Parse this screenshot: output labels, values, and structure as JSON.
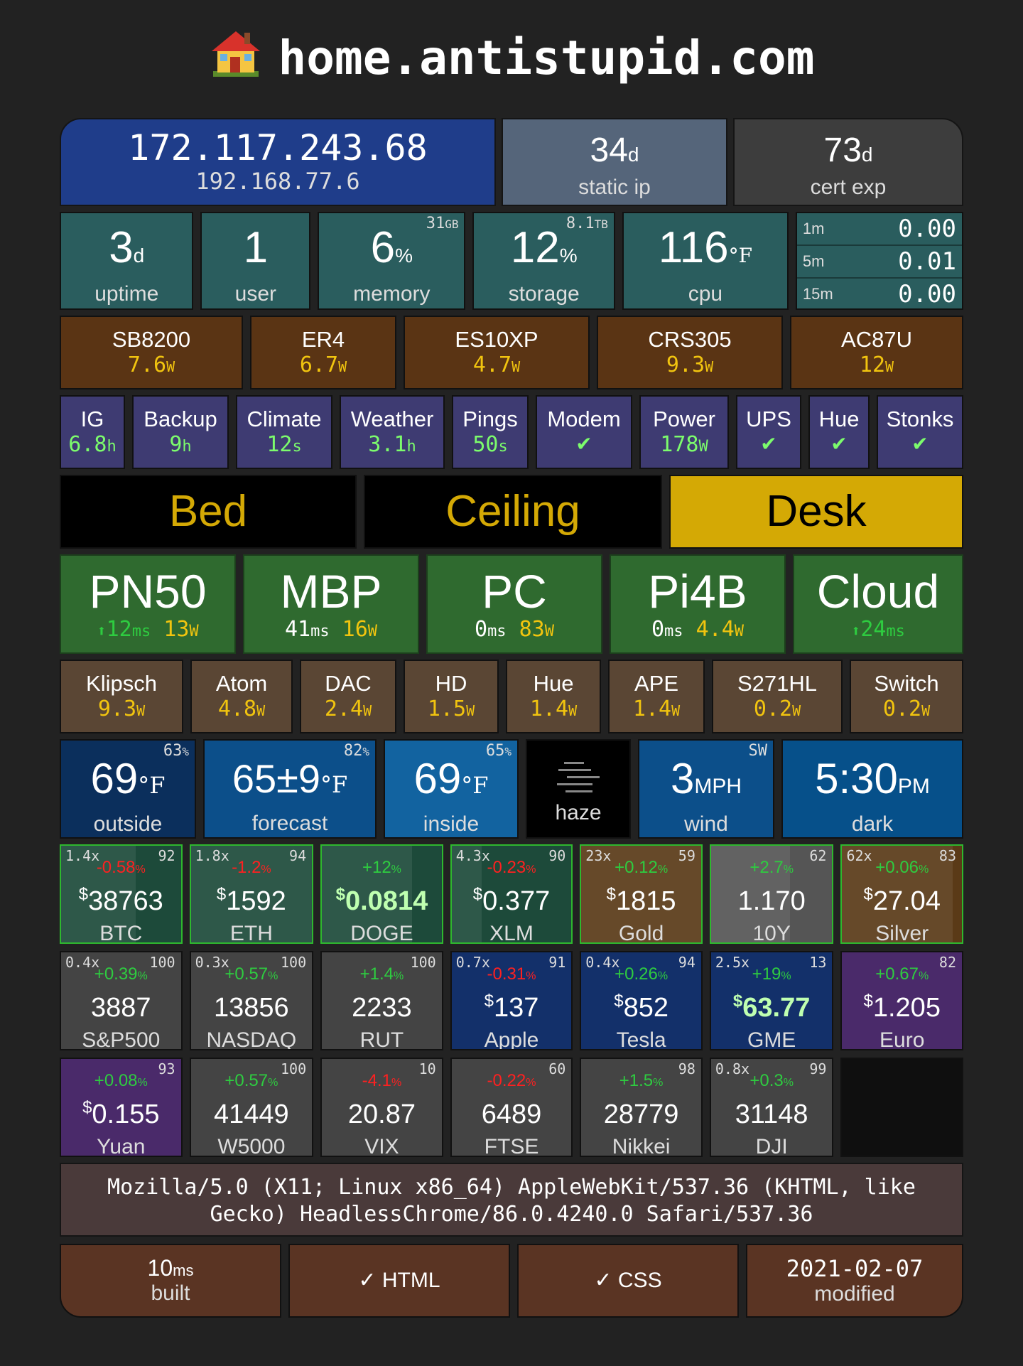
{
  "title": "home.antistupid.com",
  "network": {
    "public_ip": "172.117.243.68",
    "local_ip": "192.168.77.6",
    "static_ip": {
      "value": "34",
      "unit": "d",
      "label": "static ip"
    },
    "cert_exp": {
      "value": "73",
      "unit": "d",
      "label": "cert exp"
    }
  },
  "system": [
    {
      "value": "3",
      "unit": "d",
      "label": "uptime",
      "corner": ""
    },
    {
      "value": "1",
      "unit": "",
      "label": "user",
      "corner": ""
    },
    {
      "value": "6",
      "unit": "%",
      "label": "memory",
      "corner": "31",
      "corner_unit": "GB"
    },
    {
      "value": "12",
      "unit": "%",
      "label": "storage",
      "corner": "8.1",
      "corner_unit": "TB"
    },
    {
      "value": "116",
      "unit": "°F",
      "label": "cpu",
      "corner": ""
    }
  ],
  "load": [
    {
      "label": "1m",
      "value": "0.00"
    },
    {
      "label": "5m",
      "value": "0.01"
    },
    {
      "label": "15m",
      "value": "0.00"
    }
  ],
  "network_devices": [
    {
      "name": "SB8200",
      "value": "7.6",
      "unit": "W"
    },
    {
      "name": "ER4",
      "value": "6.7",
      "unit": "W"
    },
    {
      "name": "ES10XP",
      "value": "4.7",
      "unit": "W"
    },
    {
      "name": "CRS305",
      "value": "9.3",
      "unit": "W"
    },
    {
      "name": "AC87U",
      "value": "12",
      "unit": "W"
    }
  ],
  "jobs": [
    {
      "name": "IG",
      "value": "6.8",
      "unit": "h"
    },
    {
      "name": "Backup",
      "value": "9",
      "unit": "h"
    },
    {
      "name": "Climate",
      "value": "12",
      "unit": "s"
    },
    {
      "name": "Weather",
      "value": "3.1",
      "unit": "h"
    },
    {
      "name": "Pings",
      "value": "50",
      "unit": "s"
    },
    {
      "name": "Modem",
      "value": "✔",
      "unit": ""
    },
    {
      "name": "Power",
      "value": "178",
      "unit": "W"
    },
    {
      "name": "UPS",
      "value": "✔",
      "unit": ""
    },
    {
      "name": "Hue",
      "value": "✔",
      "unit": ""
    },
    {
      "name": "Stonks",
      "value": "✔",
      "unit": ""
    }
  ],
  "lights": [
    {
      "name": "Bed",
      "on": false
    },
    {
      "name": "Ceiling",
      "on": false
    },
    {
      "name": "Desk",
      "on": true
    }
  ],
  "machines": [
    {
      "name": "PN50",
      "arrow": "⬆",
      "ping": "12",
      "ping_unit": "ms",
      "power": "13",
      "power_unit": "W",
      "ping_green": true
    },
    {
      "name": "MBP",
      "arrow": "",
      "ping": "41",
      "ping_unit": "ms",
      "power": "16",
      "power_unit": "W",
      "ping_green": false
    },
    {
      "name": "PC",
      "arrow": "",
      "ping": "0",
      "ping_unit": "ms",
      "power": "83",
      "power_unit": "W",
      "ping_green": false
    },
    {
      "name": "Pi4B",
      "arrow": "",
      "ping": "0",
      "ping_unit": "ms",
      "power": "4.4",
      "power_unit": "W",
      "ping_green": false
    },
    {
      "name": "Cloud",
      "arrow": "⬆",
      "ping": "24",
      "ping_unit": "ms",
      "power": "",
      "power_unit": "",
      "ping_green": true
    }
  ],
  "peripherals": [
    {
      "name": "Klipsch",
      "value": "9.3",
      "unit": "W"
    },
    {
      "name": "Atom",
      "value": "4.8",
      "unit": "W"
    },
    {
      "name": "DAC",
      "value": "2.4",
      "unit": "W"
    },
    {
      "name": "HD",
      "value": "1.5",
      "unit": "W"
    },
    {
      "name": "Hue",
      "value": "1.4",
      "unit": "W"
    },
    {
      "name": "APE",
      "value": "1.4",
      "unit": "W"
    },
    {
      "name": "S271HL",
      "value": "0.2",
      "unit": "W"
    },
    {
      "name": "Switch",
      "value": "0.2",
      "unit": "W"
    }
  ],
  "weather": {
    "outside": {
      "value": "69",
      "unit": "°F",
      "label": "outside",
      "corner": "63",
      "corner_unit": "%"
    },
    "forecast": {
      "value": "65±9",
      "unit": "°F",
      "label": "forecast",
      "corner": "82",
      "corner_unit": "%"
    },
    "inside": {
      "value": "69",
      "unit": "°F",
      "label": "inside",
      "corner": "65",
      "corner_unit": "%"
    },
    "condition": {
      "label": "haze",
      "icon": "haze-icon"
    },
    "wind": {
      "value": "3",
      "unit": "MPH",
      "label": "wind",
      "corner": "SW"
    },
    "time": {
      "value": "5:30",
      "unit": "PM",
      "label": "dark"
    }
  },
  "stocks_row1": [
    {
      "name": "BTC",
      "mult": "1.4x",
      "score": "92",
      "change": "-0.58",
      "change_unit": "%",
      "dollar": "$",
      "price": "38763",
      "dir": "down",
      "bg": "#1d4a3a",
      "fill": 0.62,
      "border": "#2eb82e",
      "bold": false
    },
    {
      "name": "ETH",
      "mult": "1.8x",
      "score": "94",
      "change": "-1.2",
      "change_unit": "%",
      "dollar": "$",
      "price": "1592",
      "dir": "down",
      "bg": "#1d4a3a",
      "fill": 1.0,
      "border": "#2eb82e",
      "bold": false
    },
    {
      "name": "DOGE",
      "mult": "",
      "score": "",
      "change": "+12",
      "change_unit": "%",
      "dollar": "$",
      "price": "0.0814",
      "dir": "up",
      "bg": "#1d4a3a",
      "fill": 0.75,
      "border": "#2eb82e",
      "bold": true
    },
    {
      "name": "XLM",
      "mult": "4.3x",
      "score": "90",
      "change": "-0.23",
      "change_unit": "%",
      "dollar": "$",
      "price": "0.377",
      "dir": "down",
      "bg": "#1d4a3a",
      "fill": 0.25,
      "border": "#2eb82e",
      "bold": false
    },
    {
      "name": "Gold",
      "mult": "23x",
      "score": "59",
      "change": "+0.12",
      "change_unit": "%",
      "dollar": "$",
      "price": "1815",
      "dir": "up",
      "bg": "#5a3a17",
      "fill": 1.0,
      "border": "#2eb82e",
      "bold": false
    },
    {
      "name": "10Y",
      "mult": "",
      "score": "62",
      "change": "+2.7",
      "change_unit": "%",
      "dollar": "",
      "price": "1.170",
      "dir": "up",
      "bg": "#555555",
      "fill": 0.65,
      "border": "#2eb82e",
      "bold": false
    },
    {
      "name": "Silver",
      "mult": "62x",
      "score": "83",
      "change": "+0.06",
      "change_unit": "%",
      "dollar": "$",
      "price": "27.04",
      "dir": "up",
      "bg": "#5a3a17",
      "fill": 0.92,
      "border": "#2eb82e",
      "bold": false
    }
  ],
  "stocks_row2": [
    {
      "name": "S&P500",
      "mult": "0.4x",
      "score": "100",
      "change": "+0.39",
      "change_unit": "%",
      "dollar": "",
      "price": "3887",
      "dir": "up",
      "bg": "#444444",
      "bold": false
    },
    {
      "name": "NASDAQ",
      "mult": "0.3x",
      "score": "100",
      "change": "+0.57",
      "change_unit": "%",
      "dollar": "",
      "price": "13856",
      "dir": "up",
      "bg": "#444444",
      "bold": false
    },
    {
      "name": "RUT",
      "mult": "",
      "score": "100",
      "change": "+1.4",
      "change_unit": "%",
      "dollar": "",
      "price": "2233",
      "dir": "up",
      "bg": "#444444",
      "bold": false
    },
    {
      "name": "Apple",
      "mult": "0.7x",
      "score": "91",
      "change": "-0.31",
      "change_unit": "%",
      "dollar": "$",
      "price": "137",
      "dir": "down",
      "bg": "#13306a",
      "bold": false
    },
    {
      "name": "Tesla",
      "mult": "0.4x",
      "score": "94",
      "change": "+0.26",
      "change_unit": "%",
      "dollar": "$",
      "price": "852",
      "dir": "up",
      "bg": "#13306a",
      "bold": false
    },
    {
      "name": "GME",
      "mult": "2.5x",
      "score": "13",
      "change": "+19",
      "change_unit": "%",
      "dollar": "$",
      "price": "63.77",
      "dir": "up",
      "bg": "#13306a",
      "bold": true
    },
    {
      "name": "Euro",
      "mult": "",
      "score": "82",
      "change": "+0.67",
      "change_unit": "%",
      "dollar": "$",
      "price": "1.205",
      "dir": "up",
      "bg": "#4a2a6a",
      "bold": false
    }
  ],
  "stocks_row3": [
    {
      "name": "Yuan",
      "mult": "",
      "score": "93",
      "change": "+0.08",
      "change_unit": "%",
      "dollar": "$",
      "price": "0.155",
      "dir": "up",
      "bg": "#4a2a6a",
      "bold": false
    },
    {
      "name": "W5000",
      "mult": "",
      "score": "100",
      "change": "+0.57",
      "change_unit": "%",
      "dollar": "",
      "price": "41449",
      "dir": "up",
      "bg": "#444444",
      "bold": false
    },
    {
      "name": "VIX",
      "mult": "",
      "score": "10",
      "change": "-4.1",
      "change_unit": "%",
      "dollar": "",
      "price": "20.87",
      "dir": "down",
      "bg": "#444444",
      "bold": false
    },
    {
      "name": "FTSE",
      "mult": "",
      "score": "60",
      "change": "-0.22",
      "change_unit": "%",
      "dollar": "",
      "price": "6489",
      "dir": "down",
      "bg": "#444444",
      "bold": false
    },
    {
      "name": "Nikkei",
      "mult": "",
      "score": "98",
      "change": "+1.5",
      "change_unit": "%",
      "dollar": "",
      "price": "28779",
      "dir": "up",
      "bg": "#444444",
      "bold": false
    },
    {
      "name": "DJI",
      "mult": "0.8x",
      "score": "99",
      "change": "+0.3",
      "change_unit": "%",
      "dollar": "",
      "price": "31148",
      "dir": "up",
      "bg": "#444444",
      "bold": false
    }
  ],
  "user_agent": "Mozilla/5.0 (X11; Linux x86_64) AppleWebKit/537.36 (KHTML, like Gecko) HeadlessChrome/86.0.4240.0 Safari/537.36",
  "footer": {
    "built": {
      "value": "10",
      "unit": "ms",
      "label": "built"
    },
    "html": "✓ HTML",
    "css": "✓ CSS",
    "modified": {
      "value": "2021-02-07",
      "label": "modified"
    }
  },
  "colors": {
    "background": "#222222",
    "ip": "#1f3d8a",
    "static": "#55657a",
    "cert": "#3d3d3d",
    "system": "#2a5d5e",
    "network_dev": "#5a3414",
    "jobs": "#3e3b72",
    "light_on": "#d4a905",
    "light_off_text": "#d4a905",
    "machine": "#2f6a2f",
    "peripheral": "#5a4634",
    "footer": "#5a3423",
    "ua": "#4a3a3a"
  }
}
